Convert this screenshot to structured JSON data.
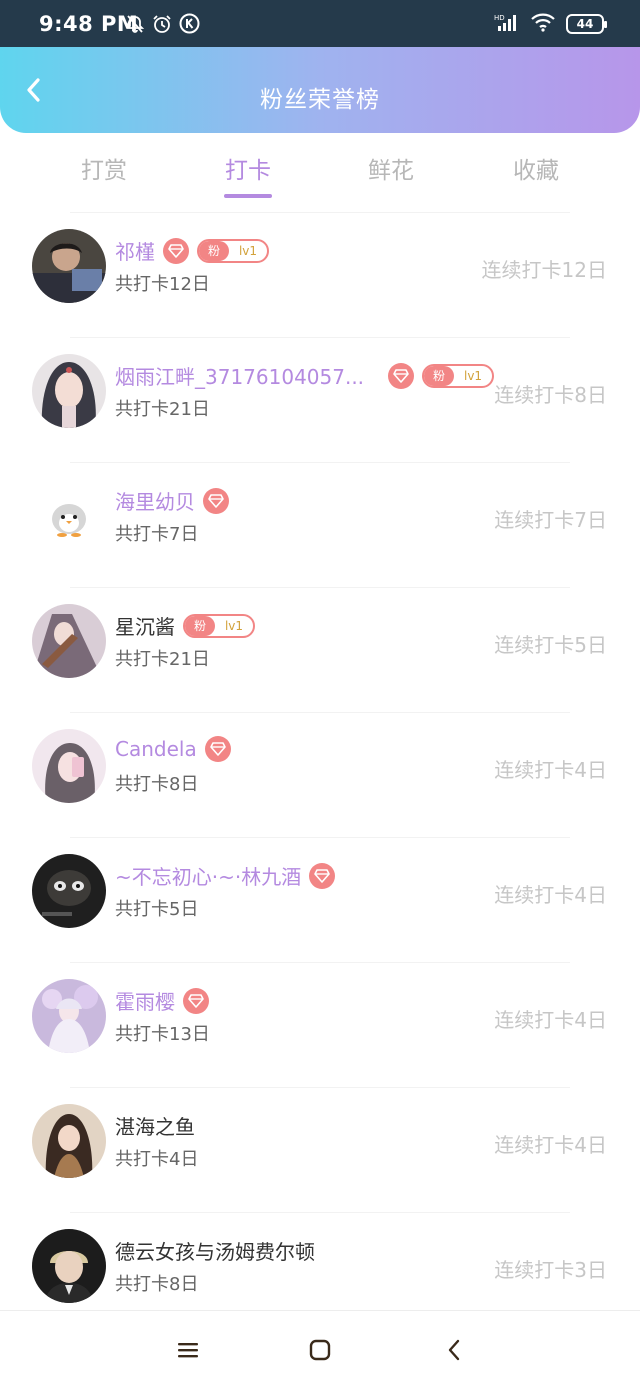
{
  "status_bar": {
    "time": "9:48 PM",
    "battery": "44",
    "icons": [
      "mute-icon",
      "alarm-icon",
      "k-app-icon",
      "signal-icon",
      "wifi-icon",
      "battery-icon"
    ]
  },
  "header": {
    "title": "粉丝荣誉榜",
    "gradient": [
      "#5fd5ee",
      "#b796ea"
    ]
  },
  "tabs": [
    {
      "label": "打赏",
      "active": false
    },
    {
      "label": "打卡",
      "active": true
    },
    {
      "label": "鲜花",
      "active": false
    },
    {
      "label": "收藏",
      "active": false
    }
  ],
  "list": [
    {
      "name": "祁槿",
      "sub": "共打卡12日",
      "streak": "连续打卡12日",
      "diamond": true,
      "fan_badge": {
        "label": "粉",
        "level": "lv1"
      },
      "highlight": true
    },
    {
      "name": "烟雨江畔_37176104057...",
      "sub": "共打卡21日",
      "streak": "连续打卡8日",
      "diamond": true,
      "fan_badge": {
        "label": "粉",
        "level": "lv1"
      },
      "highlight": true
    },
    {
      "name": "海里幼贝",
      "sub": "共打卡7日",
      "streak": "连续打卡7日",
      "diamond": true,
      "fan_badge": null,
      "highlight": true
    },
    {
      "name": "星沉酱",
      "sub": "共打卡21日",
      "streak": "连续打卡5日",
      "diamond": false,
      "fan_badge": {
        "label": "粉",
        "level": "lv1"
      },
      "highlight": false
    },
    {
      "name": "Candela",
      "sub": "共打卡8日",
      "streak": "连续打卡4日",
      "diamond": true,
      "fan_badge": null,
      "highlight": true
    },
    {
      "name": "~不忘初心·~·林九酒",
      "sub": "共打卡5日",
      "streak": "连续打卡4日",
      "diamond": true,
      "fan_badge": null,
      "highlight": true
    },
    {
      "name": "霍雨樱",
      "sub": "共打卡13日",
      "streak": "连续打卡4日",
      "diamond": true,
      "fan_badge": null,
      "highlight": true
    },
    {
      "name": "湛海之鱼",
      "sub": "共打卡4日",
      "streak": "连续打卡4日",
      "diamond": false,
      "fan_badge": null,
      "highlight": false
    },
    {
      "name": "德云女孩与汤姆费尔顿",
      "sub": "共打卡8日",
      "streak": "连续打卡3日",
      "diamond": false,
      "fan_badge": null,
      "highlight": false
    }
  ],
  "colors": {
    "accent": "#b48ae0",
    "badge": "#f28585",
    "muted": "#c6c6c6"
  },
  "bottom_nav": [
    "menu-icon",
    "home-icon",
    "back-icon"
  ]
}
